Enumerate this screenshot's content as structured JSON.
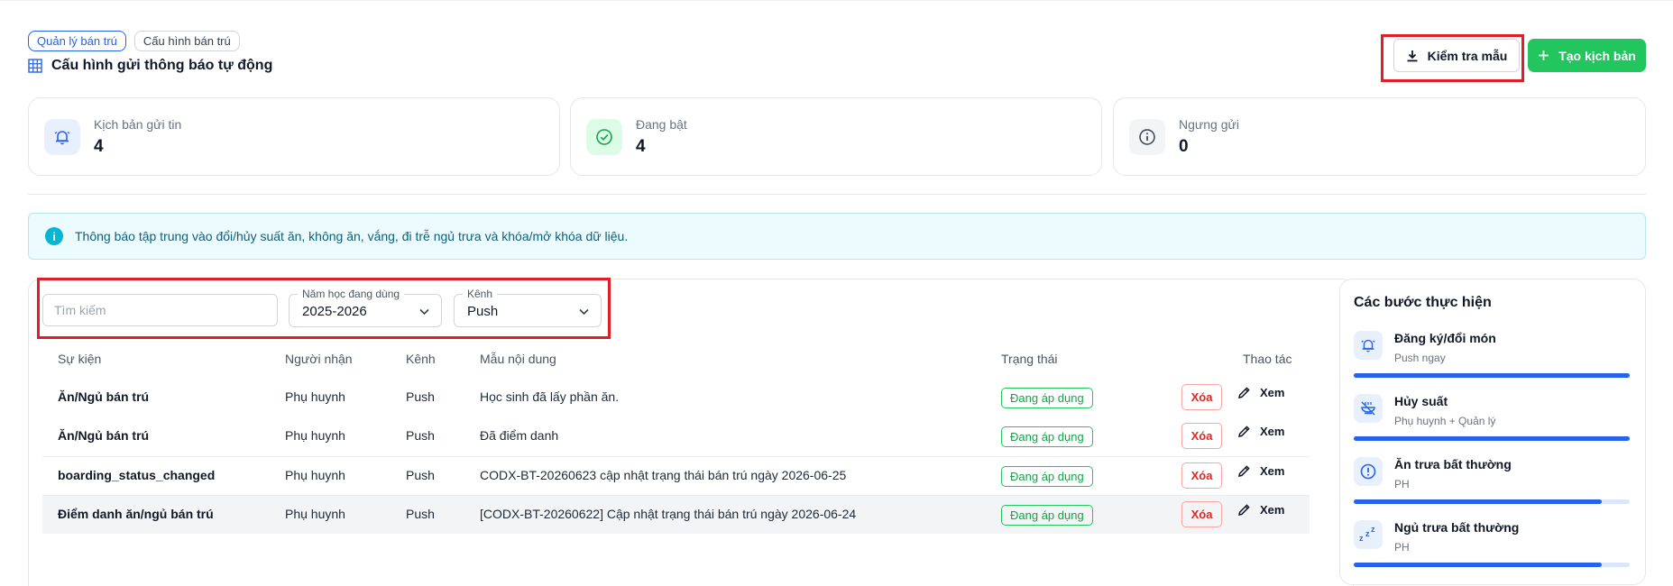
{
  "breadcrumb": [
    {
      "label": "Quản lý bán trú",
      "active": true
    },
    {
      "label": "Cấu hình bán trú",
      "active": false
    }
  ],
  "page": {
    "title": "Cấu hình gửi thông báo tự động",
    "icon": "grid-icon"
  },
  "actions": {
    "check_template_label": "Kiểm tra mẫu",
    "check_template_icon": "download-icon",
    "create_label": "Tạo kịch bản",
    "create_icon": "plus-icon",
    "create_color": "#22c55e"
  },
  "stats": [
    {
      "label": "Kịch bản gửi tin",
      "value": "4",
      "icon": "bell-icon",
      "color": "#2563eb"
    },
    {
      "label": "Đang bật",
      "value": "4",
      "icon": "check-circle-icon",
      "color": "#16a34a"
    },
    {
      "label": "Ngưng gửi",
      "value": "0",
      "icon": "info-circle-icon",
      "color": "#374151"
    }
  ],
  "banner": {
    "text": "Thông báo tập trung vào đổi/hủy suất ăn, không ăn, vắng, đi trễ ngủ trưa và khóa/mở khóa dữ liệu."
  },
  "filters": {
    "search_placeholder": "Tìm kiếm",
    "school_year_label": "Năm học đang dùng",
    "school_year_value": "2025-2026",
    "channel_label": "Kênh",
    "channel_value": "Push"
  },
  "table": {
    "headers": [
      "Sự kiện",
      "Người nhận",
      "Kênh",
      "Mẫu nội dung",
      "Trạng thái",
      "Thao tác"
    ],
    "rows": [
      {
        "event": "Ăn/Ngủ bán trú",
        "recipient": "Phụ huynh",
        "channel": "Push",
        "template": "Học sinh đã lấy phần ăn.",
        "status": "Đang áp dụng",
        "delete": "Xóa",
        "view": "Xem"
      },
      {
        "event": "Ăn/Ngủ bán trú",
        "recipient": "Phụ huynh",
        "channel": "Push",
        "template": "Đã điểm danh",
        "status": "Đang áp dụng",
        "delete": "Xóa",
        "view": "Xem"
      },
      {
        "event": "boarding_status_changed",
        "recipient": "Phụ huynh",
        "channel": "Push",
        "template": "CODX-BT-20260623 cập nhật trạng thái bán trú ngày 2026-06-25",
        "status": "Đang áp dụng",
        "delete": "Xóa",
        "view": "Xem"
      },
      {
        "event": "Điểm danh ăn/ngủ bán trú",
        "recipient": "Phụ huynh",
        "channel": "Push",
        "template": "[CODX-BT-20260622] Cập nhật trạng thái bán trú ngày 2026-06-24",
        "status": "Đang áp dụng",
        "delete": "Xóa",
        "view": "Xem"
      }
    ]
  },
  "steps": {
    "title": "Các bước thực hiện",
    "items": [
      {
        "title": "Đăng ký/đổi món",
        "subtitle": "Push ngay",
        "icon": "bell-icon",
        "progress": 1.0
      },
      {
        "title": "Hủy suất",
        "subtitle": "Phụ huynh + Quản lý",
        "icon": "cancel-food-icon",
        "progress": 1.0
      },
      {
        "title": "Ăn trưa bất thường",
        "subtitle": "PH",
        "icon": "alert-circle-icon",
        "progress": 0.9
      },
      {
        "title": "Ngủ trưa bất thường",
        "subtitle": "PH",
        "icon": "sleep-icon",
        "progress": 0.9
      }
    ]
  }
}
